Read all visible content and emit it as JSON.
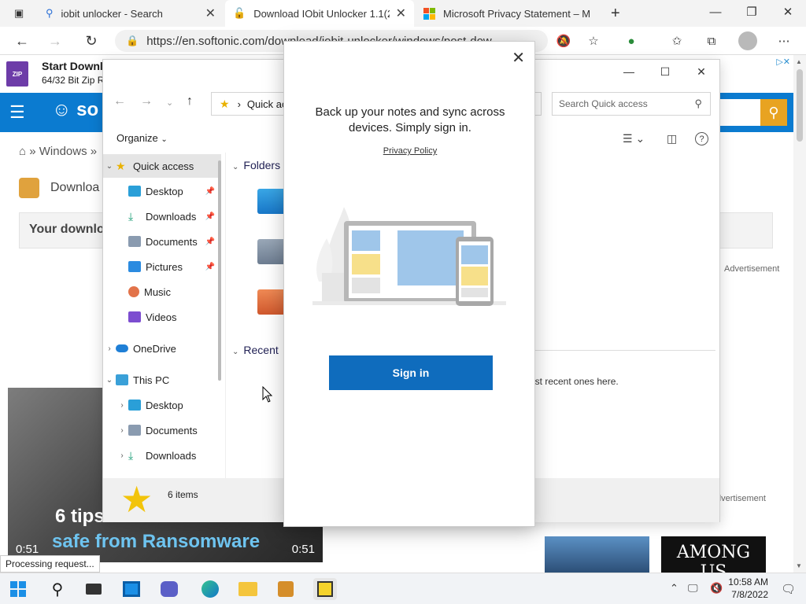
{
  "browser": {
    "tabs": [
      {
        "title": "iobit unlocker - Search",
        "close": "✕"
      },
      {
        "title": "Download IObit Unlocker 1.1(20",
        "close": "✕"
      },
      {
        "title": "Microsoft Privacy Statement – M",
        "close": ""
      }
    ],
    "new_tab": "+",
    "url": "https://en.softonic.com/download/iobit-unlocker/windows/post-dow...",
    "window_controls": {
      "minimize": "—",
      "maximize": "❐",
      "close": "✕"
    }
  },
  "page": {
    "download_bar": {
      "badge": "ZIP",
      "title": "Start Downl",
      "subtitle": "64/32 Bit Zip R"
    },
    "ad_marker": "▷✕",
    "search_placeholder": "...",
    "breadcrumb": "Windows »",
    "download_heading": "Downloa",
    "your_download": "Your downlo",
    "advertisement_1": "Advertisement",
    "advertisement_2": "dvertisement",
    "video": {
      "caption_1": "6 tips",
      "caption_2": "safe from Ransomware",
      "time_left": "0:51",
      "time_right": "0:51"
    },
    "game_2": "AMONG US",
    "status": "Processing request..."
  },
  "explorer": {
    "address": "Quick acc",
    "search_placeholder": "Search Quick access",
    "organize": "Organize",
    "sidebar": [
      {
        "label": "Quick access",
        "icon": "star-icon",
        "color": "#e9b100"
      },
      {
        "label": "Desktop",
        "icon": "desktop-icon",
        "color": "#2a9fd8"
      },
      {
        "label": "Downloads",
        "icon": "download-icon",
        "color": "#1b9e77"
      },
      {
        "label": "Documents",
        "icon": "documents-icon",
        "color": "#8a9bb0"
      },
      {
        "label": "Pictures",
        "icon": "pictures-icon",
        "color": "#2b8be0"
      },
      {
        "label": "Music",
        "icon": "music-icon",
        "color": "#e2734a"
      },
      {
        "label": "Videos",
        "icon": "videos-icon",
        "color": "#7c4dd0"
      },
      {
        "label": "OneDrive",
        "icon": "onedrive-icon",
        "color": "#1f7fd6"
      },
      {
        "label": "This PC",
        "icon": "pc-icon",
        "color": "#3aa0d8"
      },
      {
        "label": "Desktop",
        "icon": "desktop-icon",
        "color": "#2a9fd8"
      },
      {
        "label": "Documents",
        "icon": "documents-icon",
        "color": "#8a9bb0"
      },
      {
        "label": "Downloads",
        "icon": "download-icon",
        "color": "#1b9e77"
      }
    ],
    "sections": {
      "folders": "Folders",
      "recent": "Recent"
    },
    "hint": "ost recent ones here.",
    "item_count": "6 items"
  },
  "dialog": {
    "heading": "Back up your notes and sync across devices. Simply sign in.",
    "privacy_link": "Privacy Policy",
    "sign_in": "Sign in",
    "close": "✕"
  },
  "taskbar": {
    "time": "10:58 AM",
    "date": "7/8/2022"
  },
  "colors": {
    "accent_blue": "#0f6cbd",
    "site_blue": "#0b7bd0",
    "site_yellow": "#e8a321"
  }
}
